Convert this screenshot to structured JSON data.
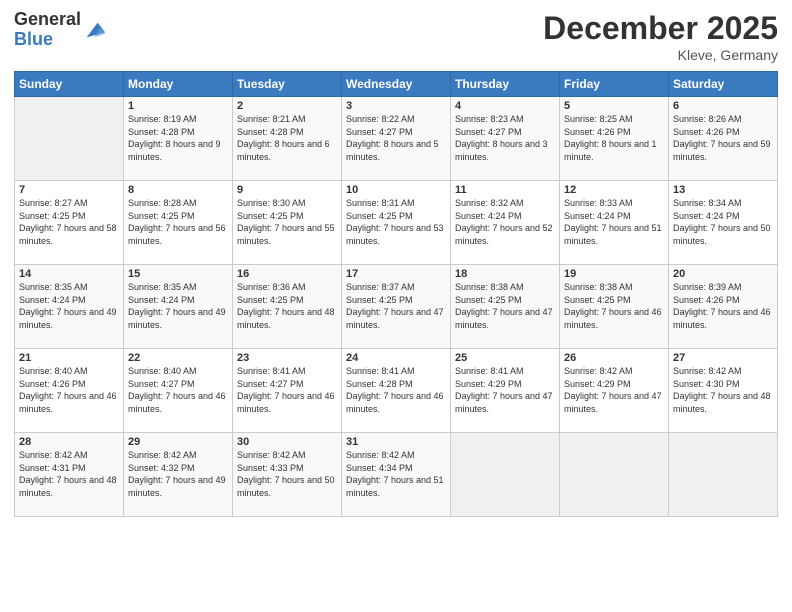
{
  "logo": {
    "general": "General",
    "blue": "Blue"
  },
  "title": "December 2025",
  "location": "Kleve, Germany",
  "days_header": [
    "Sunday",
    "Monday",
    "Tuesday",
    "Wednesday",
    "Thursday",
    "Friday",
    "Saturday"
  ],
  "weeks": [
    [
      {
        "day": "",
        "sunrise": "",
        "sunset": "",
        "daylight": "",
        "empty": true
      },
      {
        "day": "1",
        "sunrise": "Sunrise: 8:19 AM",
        "sunset": "Sunset: 4:28 PM",
        "daylight": "Daylight: 8 hours and 9 minutes."
      },
      {
        "day": "2",
        "sunrise": "Sunrise: 8:21 AM",
        "sunset": "Sunset: 4:28 PM",
        "daylight": "Daylight: 8 hours and 6 minutes."
      },
      {
        "day": "3",
        "sunrise": "Sunrise: 8:22 AM",
        "sunset": "Sunset: 4:27 PM",
        "daylight": "Daylight: 8 hours and 5 minutes."
      },
      {
        "day": "4",
        "sunrise": "Sunrise: 8:23 AM",
        "sunset": "Sunset: 4:27 PM",
        "daylight": "Daylight: 8 hours and 3 minutes."
      },
      {
        "day": "5",
        "sunrise": "Sunrise: 8:25 AM",
        "sunset": "Sunset: 4:26 PM",
        "daylight": "Daylight: 8 hours and 1 minute."
      },
      {
        "day": "6",
        "sunrise": "Sunrise: 8:26 AM",
        "sunset": "Sunset: 4:26 PM",
        "daylight": "Daylight: 7 hours and 59 minutes."
      }
    ],
    [
      {
        "day": "7",
        "sunrise": "Sunrise: 8:27 AM",
        "sunset": "Sunset: 4:25 PM",
        "daylight": "Daylight: 7 hours and 58 minutes."
      },
      {
        "day": "8",
        "sunrise": "Sunrise: 8:28 AM",
        "sunset": "Sunset: 4:25 PM",
        "daylight": "Daylight: 7 hours and 56 minutes."
      },
      {
        "day": "9",
        "sunrise": "Sunrise: 8:30 AM",
        "sunset": "Sunset: 4:25 PM",
        "daylight": "Daylight: 7 hours and 55 minutes."
      },
      {
        "day": "10",
        "sunrise": "Sunrise: 8:31 AM",
        "sunset": "Sunset: 4:25 PM",
        "daylight": "Daylight: 7 hours and 53 minutes."
      },
      {
        "day": "11",
        "sunrise": "Sunrise: 8:32 AM",
        "sunset": "Sunset: 4:24 PM",
        "daylight": "Daylight: 7 hours and 52 minutes."
      },
      {
        "day": "12",
        "sunrise": "Sunrise: 8:33 AM",
        "sunset": "Sunset: 4:24 PM",
        "daylight": "Daylight: 7 hours and 51 minutes."
      },
      {
        "day": "13",
        "sunrise": "Sunrise: 8:34 AM",
        "sunset": "Sunset: 4:24 PM",
        "daylight": "Daylight: 7 hours and 50 minutes."
      }
    ],
    [
      {
        "day": "14",
        "sunrise": "Sunrise: 8:35 AM",
        "sunset": "Sunset: 4:24 PM",
        "daylight": "Daylight: 7 hours and 49 minutes."
      },
      {
        "day": "15",
        "sunrise": "Sunrise: 8:35 AM",
        "sunset": "Sunset: 4:24 PM",
        "daylight": "Daylight: 7 hours and 49 minutes."
      },
      {
        "day": "16",
        "sunrise": "Sunrise: 8:36 AM",
        "sunset": "Sunset: 4:25 PM",
        "daylight": "Daylight: 7 hours and 48 minutes."
      },
      {
        "day": "17",
        "sunrise": "Sunrise: 8:37 AM",
        "sunset": "Sunset: 4:25 PM",
        "daylight": "Daylight: 7 hours and 47 minutes."
      },
      {
        "day": "18",
        "sunrise": "Sunrise: 8:38 AM",
        "sunset": "Sunset: 4:25 PM",
        "daylight": "Daylight: 7 hours and 47 minutes."
      },
      {
        "day": "19",
        "sunrise": "Sunrise: 8:38 AM",
        "sunset": "Sunset: 4:25 PM",
        "daylight": "Daylight: 7 hours and 46 minutes."
      },
      {
        "day": "20",
        "sunrise": "Sunrise: 8:39 AM",
        "sunset": "Sunset: 4:26 PM",
        "daylight": "Daylight: 7 hours and 46 minutes."
      }
    ],
    [
      {
        "day": "21",
        "sunrise": "Sunrise: 8:40 AM",
        "sunset": "Sunset: 4:26 PM",
        "daylight": "Daylight: 7 hours and 46 minutes."
      },
      {
        "day": "22",
        "sunrise": "Sunrise: 8:40 AM",
        "sunset": "Sunset: 4:27 PM",
        "daylight": "Daylight: 7 hours and 46 minutes."
      },
      {
        "day": "23",
        "sunrise": "Sunrise: 8:41 AM",
        "sunset": "Sunset: 4:27 PM",
        "daylight": "Daylight: 7 hours and 46 minutes."
      },
      {
        "day": "24",
        "sunrise": "Sunrise: 8:41 AM",
        "sunset": "Sunset: 4:28 PM",
        "daylight": "Daylight: 7 hours and 46 minutes."
      },
      {
        "day": "25",
        "sunrise": "Sunrise: 8:41 AM",
        "sunset": "Sunset: 4:29 PM",
        "daylight": "Daylight: 7 hours and 47 minutes."
      },
      {
        "day": "26",
        "sunrise": "Sunrise: 8:42 AM",
        "sunset": "Sunset: 4:29 PM",
        "daylight": "Daylight: 7 hours and 47 minutes."
      },
      {
        "day": "27",
        "sunrise": "Sunrise: 8:42 AM",
        "sunset": "Sunset: 4:30 PM",
        "daylight": "Daylight: 7 hours and 48 minutes."
      }
    ],
    [
      {
        "day": "28",
        "sunrise": "Sunrise: 8:42 AM",
        "sunset": "Sunset: 4:31 PM",
        "daylight": "Daylight: 7 hours and 48 minutes."
      },
      {
        "day": "29",
        "sunrise": "Sunrise: 8:42 AM",
        "sunset": "Sunset: 4:32 PM",
        "daylight": "Daylight: 7 hours and 49 minutes."
      },
      {
        "day": "30",
        "sunrise": "Sunrise: 8:42 AM",
        "sunset": "Sunset: 4:33 PM",
        "daylight": "Daylight: 7 hours and 50 minutes."
      },
      {
        "day": "31",
        "sunrise": "Sunrise: 8:42 AM",
        "sunset": "Sunset: 4:34 PM",
        "daylight": "Daylight: 7 hours and 51 minutes."
      },
      {
        "day": "",
        "sunrise": "",
        "sunset": "",
        "daylight": "",
        "empty": true
      },
      {
        "day": "",
        "sunrise": "",
        "sunset": "",
        "daylight": "",
        "empty": true
      },
      {
        "day": "",
        "sunrise": "",
        "sunset": "",
        "daylight": "",
        "empty": true
      }
    ]
  ]
}
